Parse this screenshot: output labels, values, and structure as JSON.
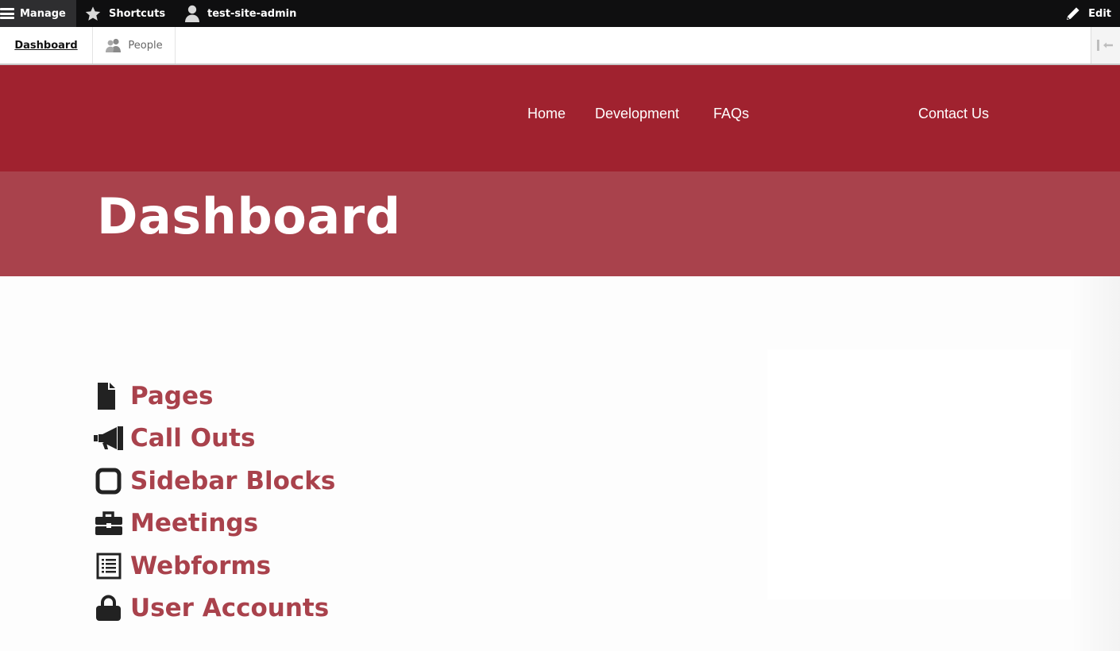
{
  "admin_bar": {
    "manage": "Manage",
    "shortcuts": "Shortcuts",
    "user": "test-site-admin",
    "edit": "Edit"
  },
  "tray": {
    "dashboard": "Dashboard",
    "people": "People"
  },
  "nav": {
    "items": [
      "Home",
      "Development",
      "FAQs",
      "Contact Us"
    ]
  },
  "page": {
    "title": "Dashboard"
  },
  "dashboard_links": [
    {
      "label": "Pages",
      "icon": "file-icon"
    },
    {
      "label": "Call Outs",
      "icon": "bullhorn-icon"
    },
    {
      "label": "Sidebar Blocks",
      "icon": "rounded-square-icon"
    },
    {
      "label": "Meetings",
      "icon": "briefcase-icon"
    },
    {
      "label": "Webforms",
      "icon": "list-form-icon"
    },
    {
      "label": "User Accounts",
      "icon": "lock-icon"
    }
  ],
  "colors": {
    "header": "#a0222f",
    "hero": "#a9424c",
    "link": "#a9424c",
    "toolbar": "#0f0f10"
  }
}
